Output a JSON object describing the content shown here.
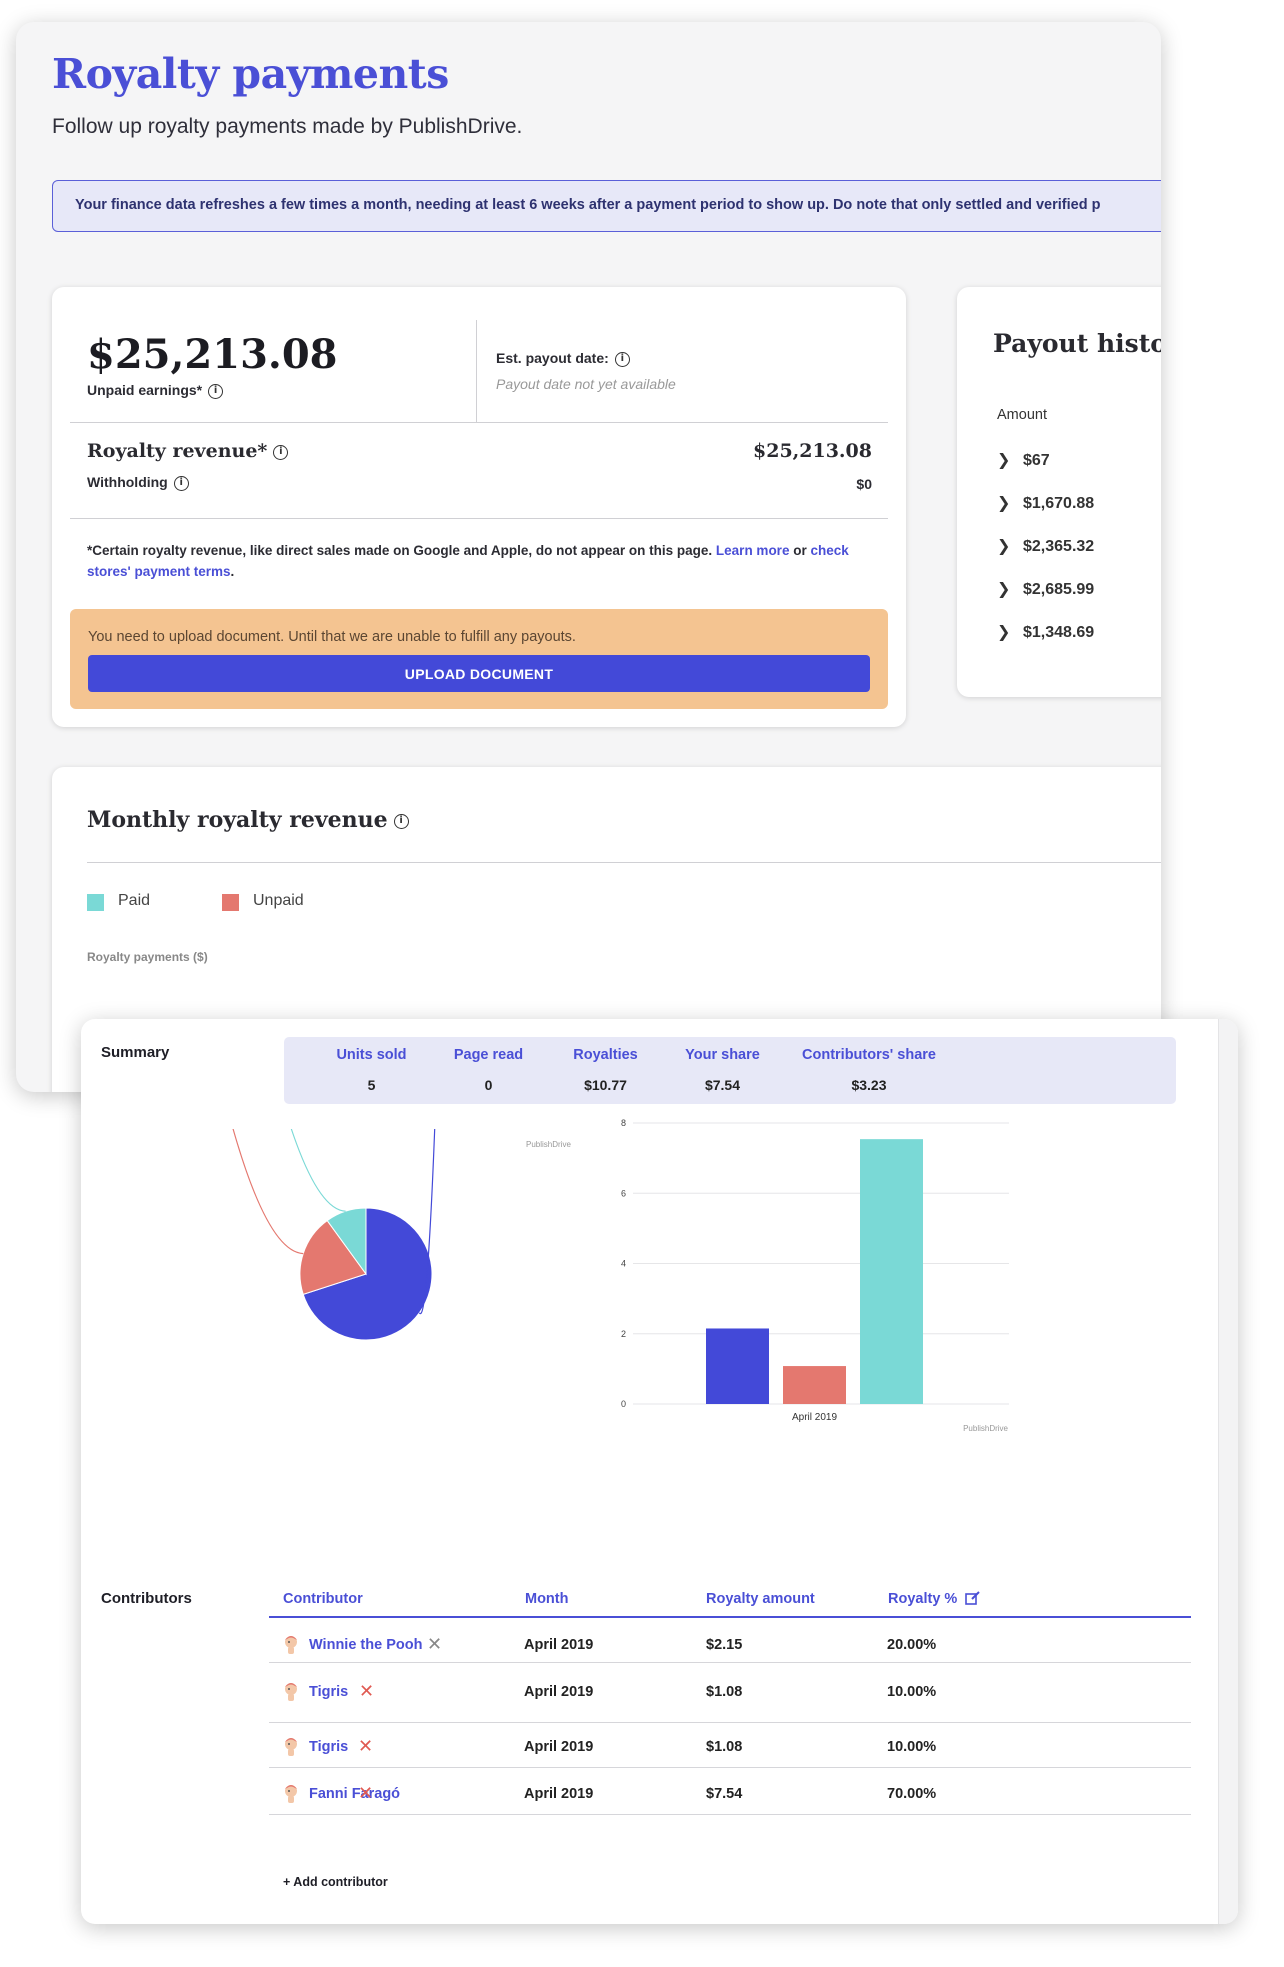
{
  "page": {
    "title": "Royalty payments",
    "subtitle": "Follow up royalty payments made by PublishDrive.",
    "notice": "Your finance data refreshes a few times a month, needing at least 6 weeks after a payment period to show up. Do note that only settled and verified p"
  },
  "earnings": {
    "amount": "$25,213.08",
    "unpaid_label": "Unpaid earnings*",
    "est_payout_label": "Est. payout date:",
    "est_payout_value": "Payout date not yet available",
    "royalty_revenue_label": "Royalty revenue*",
    "royalty_revenue_value": "$25,213.08",
    "withholding_label": "Withholding",
    "withholding_value": "$0",
    "footnote_text": "*Certain royalty revenue, like direct sales made on Google and Apple, do not appear on this page.",
    "footnote_link1": "Learn more",
    "footnote_or": "or",
    "footnote_link2": "check stores' payment terms",
    "warning_text": "You need to upload document. Until that we are unable to fulfill any payouts.",
    "upload_button": "UPLOAD DOCUMENT"
  },
  "payout_history": {
    "title": "Payout histor",
    "amount_header": "Amount",
    "amounts": [
      "$67",
      "$1,670.88",
      "$2,365.32",
      "$2,685.99",
      "$1,348.69"
    ]
  },
  "monthly": {
    "title": "Monthly royalty revenue",
    "legend": [
      {
        "label": "Paid",
        "color": "#7ad9d6"
      },
      {
        "label": "Unpaid",
        "color": "#e4786f"
      }
    ],
    "y_label": "Royalty payments ($)"
  },
  "summary": {
    "label": "Summary",
    "columns": [
      {
        "header": "Units sold",
        "value": "5"
      },
      {
        "header": "Page read",
        "value": "0"
      },
      {
        "header": "Royalties",
        "value": "$10.77"
      },
      {
        "header": "Your share",
        "value": "$7.54"
      },
      {
        "header": "Contributors' share",
        "value": "$3.23"
      }
    ]
  },
  "colors": {
    "accent": "#4349d8",
    "teal": "#7ad9d6",
    "salmon": "#e4786f",
    "warning_bg": "#f4c491"
  },
  "chart_data": [
    {
      "type": "pie",
      "title": "",
      "labels": [
        "Fanni Faragó",
        "Winnie the Pooh",
        "Tigris"
      ],
      "values": [
        70,
        20,
        10
      ],
      "colors": [
        "#4349d8",
        "#e4786f",
        "#7ad9d6"
      ],
      "credit": "PublishDrive"
    },
    {
      "type": "bar",
      "title": "",
      "categories": [
        "April 2019"
      ],
      "series": [
        {
          "values": [
            2.15
          ],
          "color": "#4349d8"
        },
        {
          "values": [
            1.08
          ],
          "color": "#e4786f"
        },
        {
          "values": [
            7.54
          ],
          "color": "#7ad9d6"
        }
      ],
      "ylim": [
        0,
        8
      ],
      "yticks": [
        "0",
        "2",
        "4",
        "6",
        "8"
      ],
      "grid": true,
      "credit": "PublishDrive"
    }
  ],
  "contributors": {
    "label": "Contributors",
    "headers": {
      "contributor": "Contributor",
      "month": "Month",
      "amount": "Royalty amount",
      "percent": "Royalty %"
    },
    "rows": [
      {
        "name": "Winnie the Pooh",
        "month": "April 2019",
        "amount": "$2.15",
        "percent": "20.00%"
      },
      {
        "name": "Tigris",
        "month": "April 2019",
        "amount": "$1.08",
        "percent": "10.00%"
      },
      {
        "name": "Tigris",
        "month": "April 2019",
        "amount": "$1.08",
        "percent": "10.00%"
      },
      {
        "name": "Fanni Faragó",
        "month": "April 2019",
        "amount": "$7.54",
        "percent": "70.00%"
      }
    ],
    "add_label": "+ Add contributor"
  }
}
